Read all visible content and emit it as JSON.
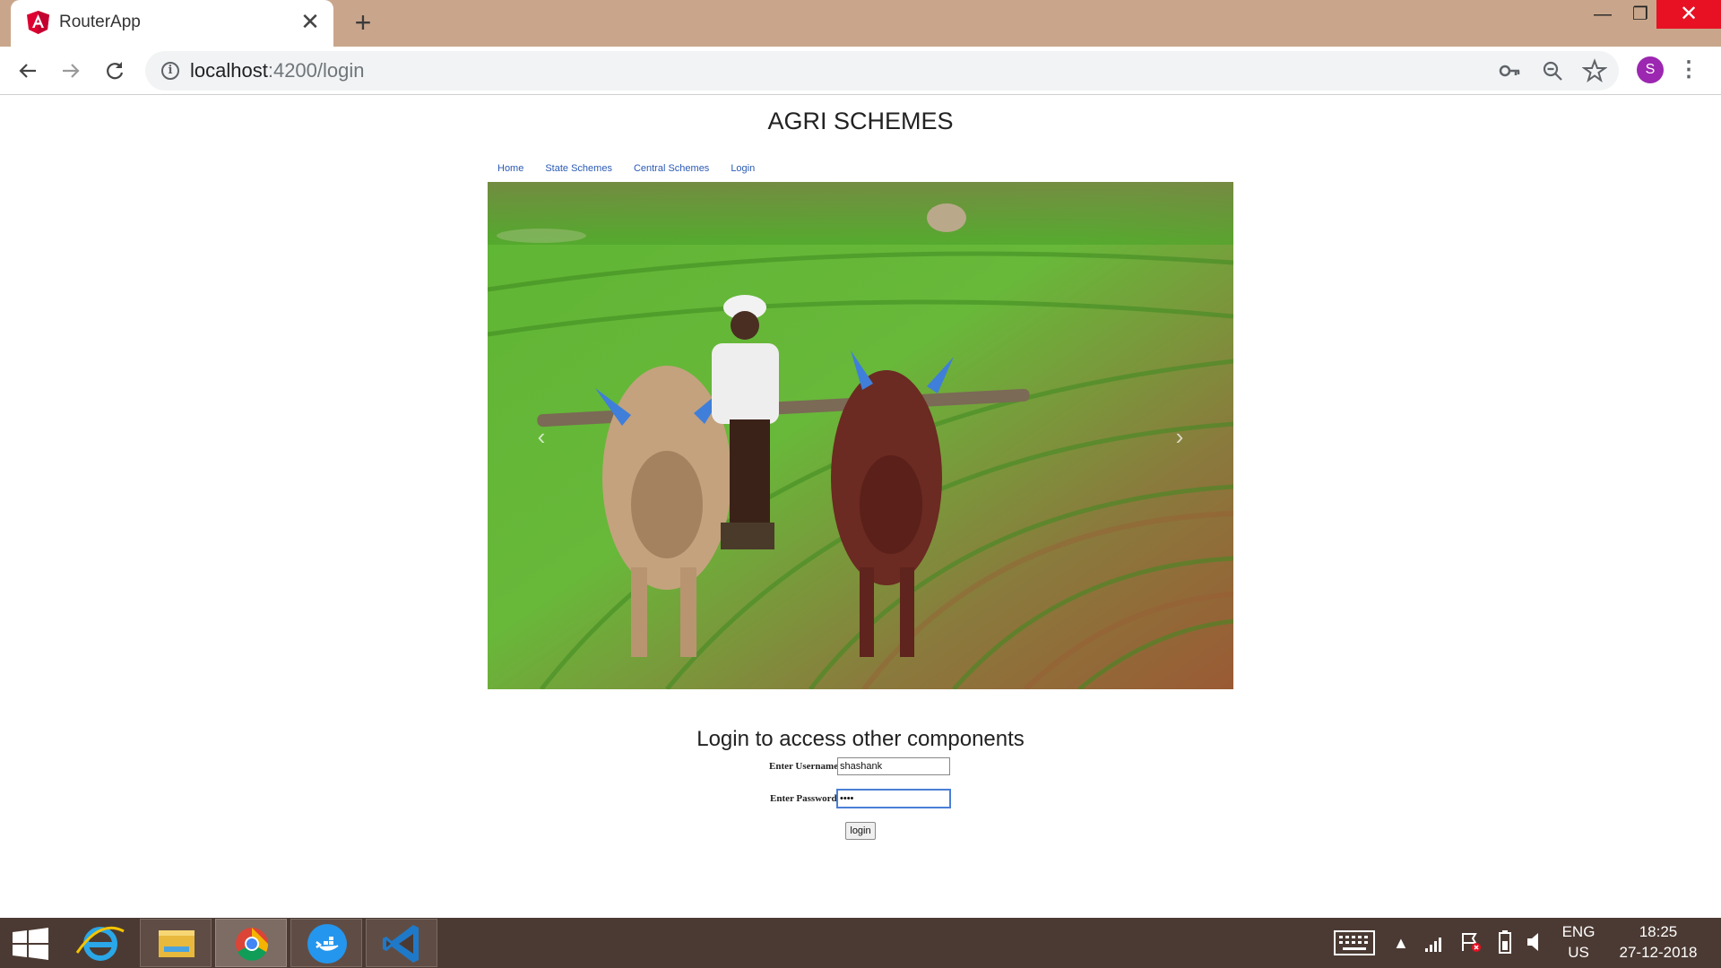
{
  "browser": {
    "tab_title": "RouterApp",
    "close_glyph": "✕",
    "new_tab_glyph": "+",
    "url_host": "localhost",
    "url_path": ":4200/login",
    "profile_initial": "S",
    "window_controls": {
      "minimize": "—",
      "maximize": "❐",
      "close": "✕"
    },
    "icons": [
      "back-arrow-icon",
      "forward-arrow-icon",
      "reload-icon",
      "site-info-icon",
      "key-icon",
      "zoom-out-icon",
      "star-icon",
      "menu-dots-icon"
    ]
  },
  "page": {
    "title": "AGRI SCHEMES",
    "nav": [
      {
        "label": "Home"
      },
      {
        "label": "State Schemes"
      },
      {
        "label": "Central Schemes"
      },
      {
        "label": "Login"
      }
    ],
    "carousel": {
      "prev": "‹",
      "next": "›"
    }
  },
  "login": {
    "heading": "Login to access other components",
    "username_label": "Enter Username",
    "username_value": "shashank",
    "password_label": "Enter Password",
    "password_value": "••••",
    "button_label": "login"
  },
  "taskbar": {
    "apps": [
      "windows-start-icon",
      "internet-explorer-icon",
      "file-explorer-icon",
      "chrome-icon",
      "docker-icon",
      "vscode-icon"
    ],
    "language_line1": "ENG",
    "language_line2": "US",
    "time": "18:25",
    "date": "27-12-2018"
  },
  "colors": {
    "titlebar": "#c9a68b",
    "taskbar": "#4b3a33",
    "close_red": "#e81123",
    "angular_red": "#dd0031",
    "link_blue": "#2a5ab4",
    "avatar_purple": "#9c27b0"
  }
}
